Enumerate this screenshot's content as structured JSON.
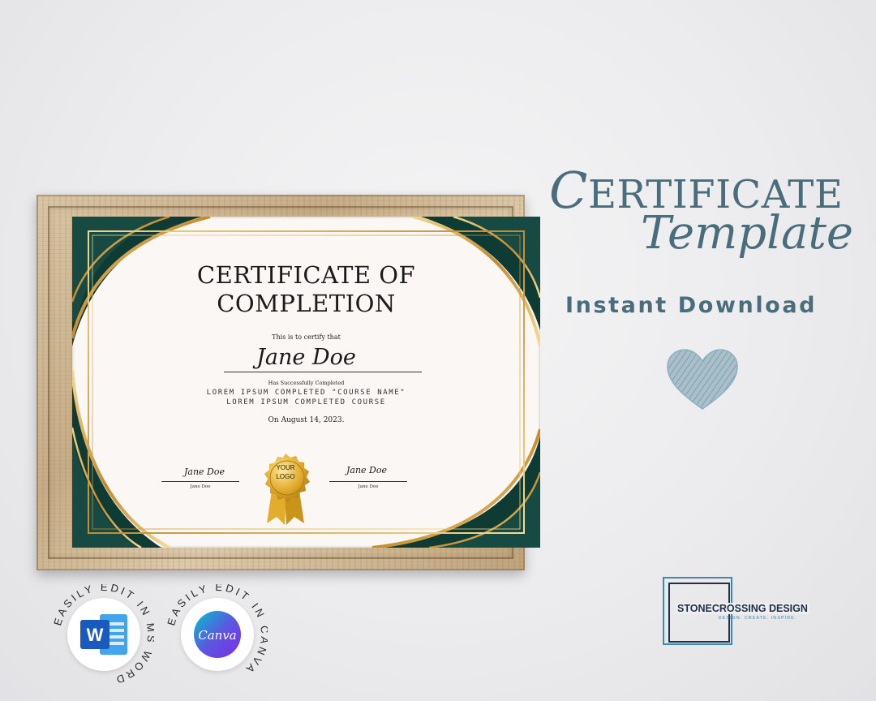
{
  "certificate": {
    "title_line1": "CERTIFICATE OF",
    "title_line2": "COMPLETION",
    "certify_text": "This is to certify that",
    "recipient": "Jane Doe",
    "completed_text": "Has Successfully Completed",
    "course_line1": "LOREM IPSUM COMPLETED \"COURSE NAME\"",
    "course_line2": "LOREM IPSUM COMPLETED COURSE",
    "date": "On August 14, 2023.",
    "signature_left": {
      "script": "Jane Doe",
      "name": "Jane Doe"
    },
    "signature_right": {
      "script": "Jane Doe",
      "name": "Jane Doe"
    },
    "seal": {
      "line1": "YOUR",
      "line2": "LOGO"
    }
  },
  "promo": {
    "heading_first_letter": "C",
    "heading_rest": "ERTIFICATE",
    "heading2": "Template",
    "subheading": "Instant Download",
    "accent_color": "#4a6d7c",
    "heart_icon": "heart-icon"
  },
  "brand": {
    "name": "STONECROSSING DESIGN",
    "tagline": "DESIGN. CREATE. INSPIRE."
  },
  "badges": {
    "word": {
      "curved_text": "EASILY EDIT IN MS WORD",
      "icon": "word-icon"
    },
    "canva": {
      "curved_text": "EASILY EDIT IN CANVA",
      "icon_text": "Canva"
    }
  },
  "colors": {
    "frame_wood": "#c7ad86",
    "cert_green": "#0f3b35",
    "cert_gold": "#c9962e",
    "word_blue": "#185abd",
    "canva_teal": "#00c4cc",
    "canva_purple": "#7d2ae8"
  }
}
